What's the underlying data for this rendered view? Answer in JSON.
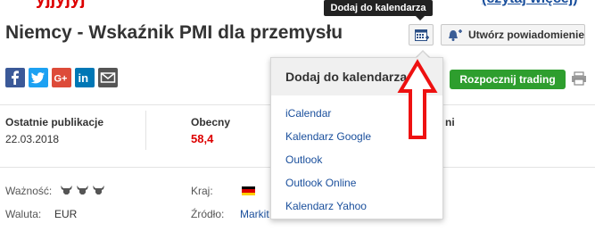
{
  "header": {
    "top_partial_text": "yjjyjyj",
    "top_partial_link": "(czytaj więcej)",
    "title": "Niemcy - Wskaźnik PMI dla przemysłu",
    "calendar_tooltip": "Dodaj do kalendarza",
    "create_alert_label": "Utwórz powiadomienie"
  },
  "toolbar": {
    "share_icons": [
      "facebook-icon",
      "twitter-icon",
      "google-plus-icon",
      "linkedin-icon",
      "email-icon"
    ],
    "start_trading_label": "Rozpocznij trading"
  },
  "stats": {
    "last_release_label": "Ostatnie publikacje",
    "last_release_date": "22.03.2018",
    "current_label": "Obecny",
    "current_value": "58,4",
    "hidden_column_suffix": "ni"
  },
  "details": {
    "importance_label": "Ważność:",
    "importance_level": 3,
    "currency_label": "Waluta:",
    "currency_value": "EUR",
    "country_label": "Kraj:",
    "source_label": "Źródło:",
    "source_value": "Markit"
  },
  "calendar_dropdown": {
    "title": "Dodaj do kalendarza",
    "items": [
      "iCalendar",
      "Kalendarz Google",
      "Outlook",
      "Outlook Online",
      "Kalendarz Yahoo"
    ]
  },
  "colors": {
    "accent_red": "#dd0000",
    "link_blue": "#1a4f9c",
    "trade_green": "#2e9e2e",
    "facebook": "#3b5998",
    "twitter": "#1da1f2",
    "google_plus": "#dd4b39",
    "linkedin": "#0077b5"
  }
}
